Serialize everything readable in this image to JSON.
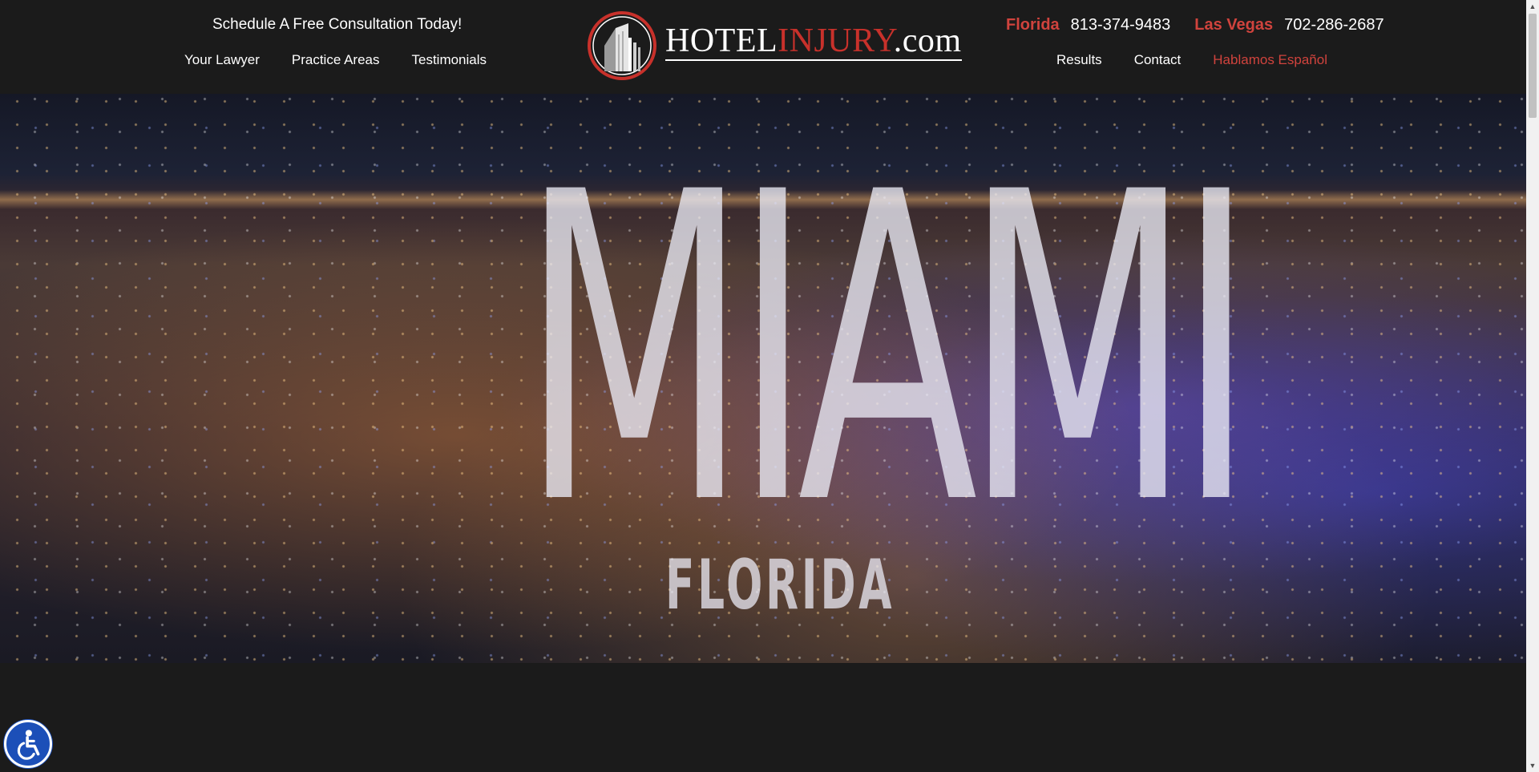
{
  "header": {
    "cta_text": "Schedule A Free Consultation Today!",
    "nav_left": [
      "Your Lawyer",
      "Practice Areas",
      "Testimonials"
    ],
    "nav_right": [
      "Results",
      "Contact",
      "Hablamos Español"
    ],
    "phones": [
      {
        "region": "Florida",
        "number": "813-374-9483"
      },
      {
        "region": "Las Vegas",
        "number": "702-286-2687"
      }
    ],
    "logo": {
      "part1": "HOTEL",
      "part2": "INJURY",
      "part3": ".com"
    }
  },
  "hero": {
    "title": "MIAMI",
    "subtitle": "FLORIDA"
  },
  "icons": {
    "accessibility": "accessibility-icon",
    "logo_mark": "building-icon",
    "scroll_up": "triangle-up-icon",
    "scroll_down": "triangle-down-icon"
  },
  "colors": {
    "background": "#1b1b1b",
    "accent_red": "#d0433d",
    "accessibility_blue": "#1c4fb8"
  }
}
